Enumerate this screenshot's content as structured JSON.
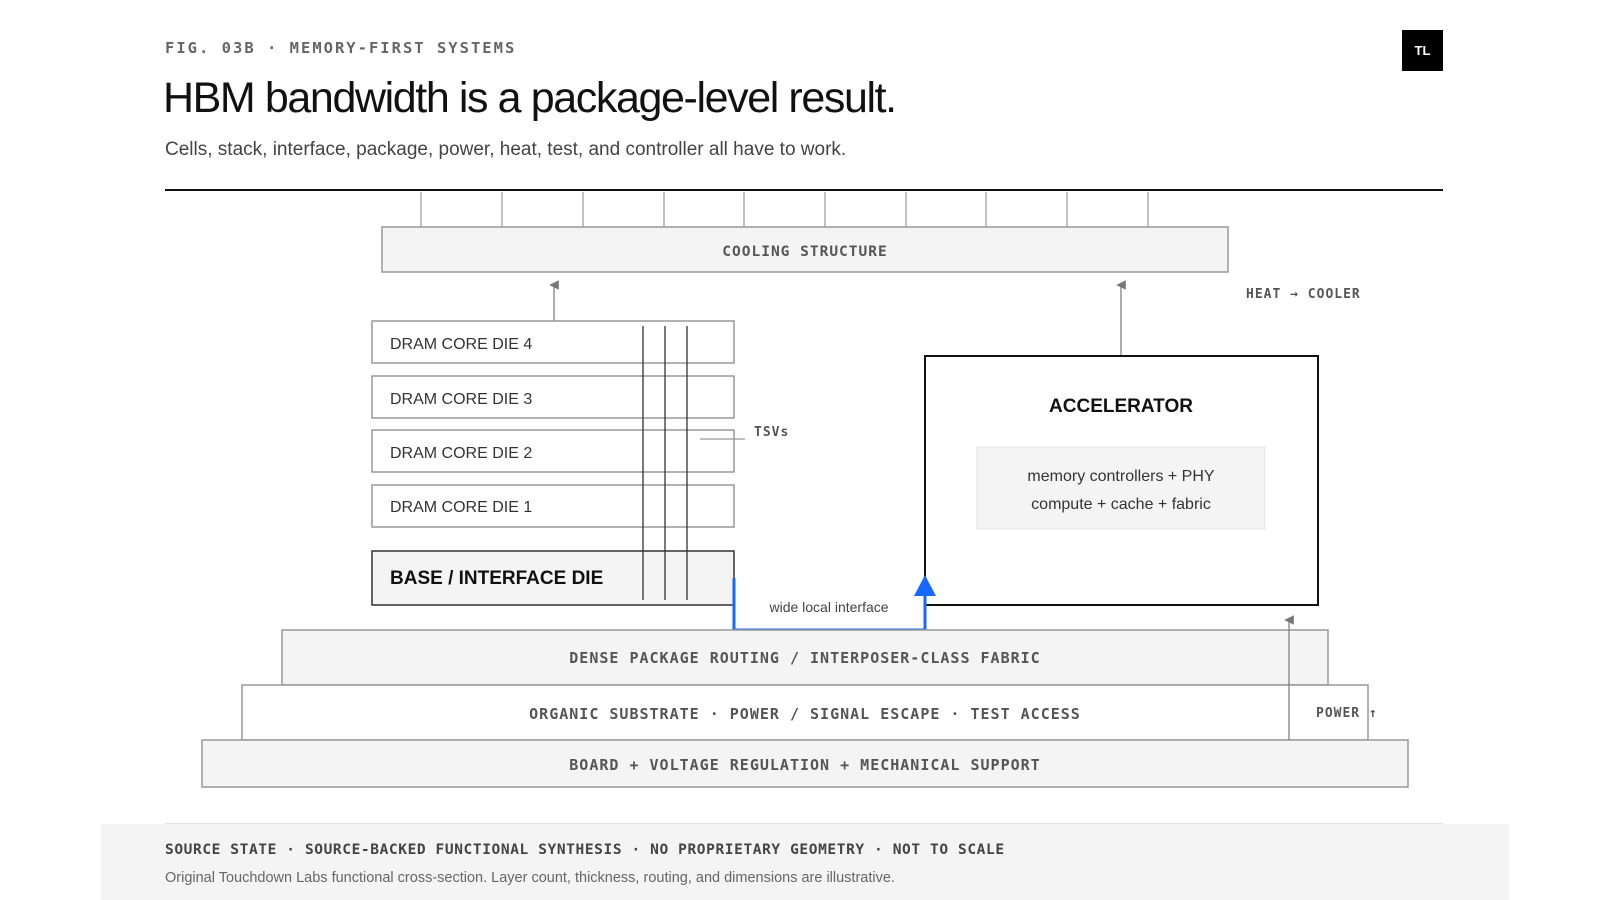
{
  "header": {
    "kicker": "FIG. 03B · MEMORY-FIRST SYSTEMS",
    "logo": "TL",
    "title": "HBM bandwidth is a package-level result.",
    "subtitle": "Cells, stack, interface, package, power, heat, test, and controller all have to work."
  },
  "diagram": {
    "cooling": "COOLING STRUCTURE",
    "heat_label": "HEAT → COOLER",
    "dram_dies": [
      "DRAM CORE DIE 4",
      "DRAM CORE DIE 3",
      "DRAM CORE DIE 2",
      "DRAM CORE DIE 1"
    ],
    "tsv_label": "TSVs",
    "base_die": "BASE / INTERFACE DIE",
    "accelerator": {
      "title": "ACCELERATOR",
      "line1": "memory controllers + PHY",
      "line2": "compute + cache + fabric"
    },
    "interface_label": "wide local interface",
    "routing": "DENSE PACKAGE ROUTING / INTERPOSER-CLASS FABRIC",
    "substrate": "ORGANIC SUBSTRATE · POWER / SIGNAL ESCAPE · TEST ACCESS",
    "board": "BOARD + VOLTAGE REGULATION + MECHANICAL SUPPORT",
    "power_label": "POWER ↑",
    "colors": {
      "interface": "#1668ff",
      "panel": "#f4f4f4",
      "stroke": "#999999"
    }
  },
  "footer": {
    "source": "SOURCE STATE · SOURCE-BACKED FUNCTIONAL SYNTHESIS · NO PROPRIETARY GEOMETRY · NOT TO SCALE",
    "note": "Original Touchdown Labs functional cross-section. Layer count, thickness, routing, and dimensions are illustrative."
  }
}
